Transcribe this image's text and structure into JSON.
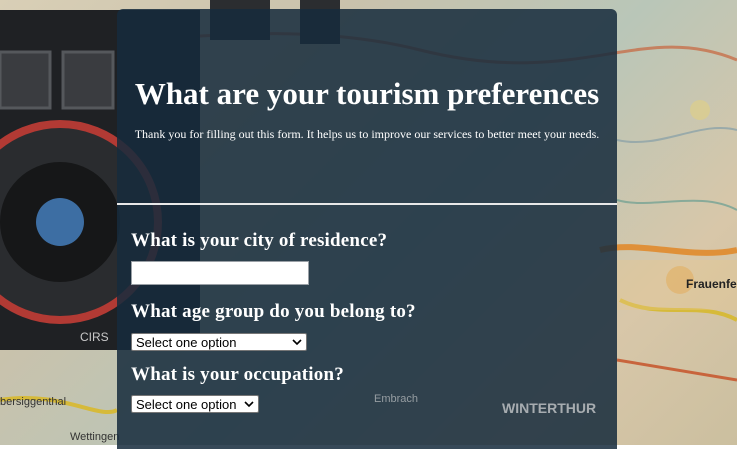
{
  "form": {
    "title": "What are your tourism preferences",
    "subtitle": "Thank you for filling out this form. It helps us to improve our services to better meet your needs."
  },
  "questions": {
    "city": {
      "label": "What is your city of residence?",
      "value": ""
    },
    "age_group": {
      "label": "What age group do you belong to?",
      "selected": "Select one option"
    },
    "occupation": {
      "label": "What is your occupation?",
      "selected": "Select one option"
    }
  },
  "map_labels": {
    "winterthur": "WINTERTHUR",
    "frauenfeld": "Frauenfel",
    "embrach": "Embrach",
    "wettingen": "Wettingen",
    "baden": "bersiggenthal"
  },
  "colors": {
    "panel": "#162b3d",
    "text": "#ffffff"
  }
}
